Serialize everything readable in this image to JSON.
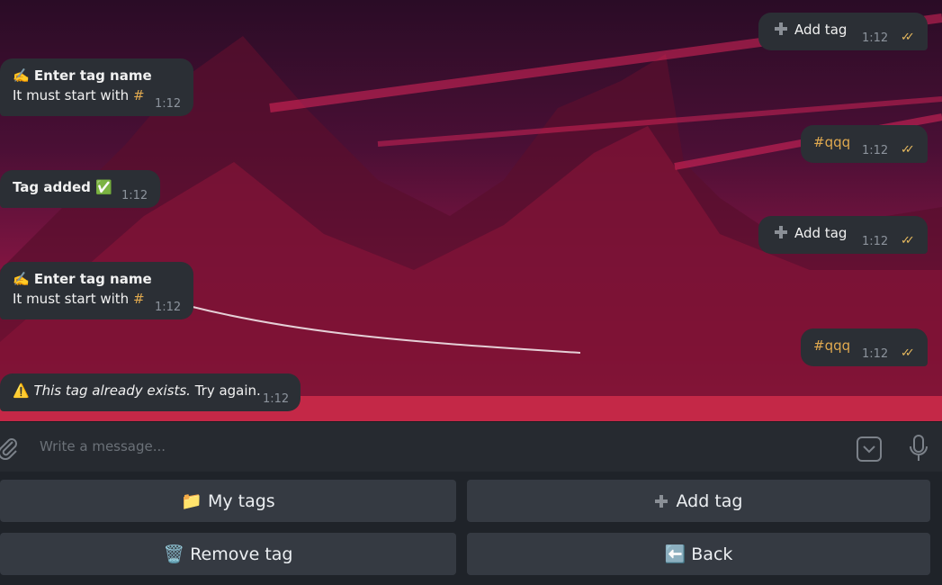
{
  "messages": {
    "m1": {
      "line1": "✍️ Enter tag name",
      "line2": "It must start with ",
      "hash": "#",
      "time": "1:12"
    },
    "m2": {
      "text": "Tag added ✅",
      "time": "1:12"
    },
    "m3": {
      "line1": "✍️ Enter tag name",
      "line2": "It must start with ",
      "hash": "#",
      "time": "1:12"
    },
    "m4": {
      "icon": "⚠️",
      "italic": "This tag already exists.",
      "rest": " Try again.",
      "time": "1:12"
    },
    "o1": {
      "text": "Add tag",
      "time": "1:12"
    },
    "o2": {
      "text": "#qqq",
      "time": "1:12"
    },
    "o3": {
      "text": "Add tag",
      "time": "1:12"
    },
    "o4": {
      "text": "#qqq",
      "time": "1:12"
    }
  },
  "composer": {
    "placeholder": "Write a message..."
  },
  "keyboard": {
    "my_tags": "📁 My tags",
    "add_tag": "Add tag",
    "remove_tag": "🗑️ Remove tag",
    "back": "⬅️ Back"
  },
  "colors": {
    "bubble": "#2b2f35",
    "accent": "#e6b95e",
    "background_top": "#2a0c26",
    "background_bottom": "#e0395a"
  },
  "icons": [
    "attach-icon",
    "emoji-icon",
    "microphone-icon",
    "plus-icon",
    "read-checkmarks-icon"
  ]
}
